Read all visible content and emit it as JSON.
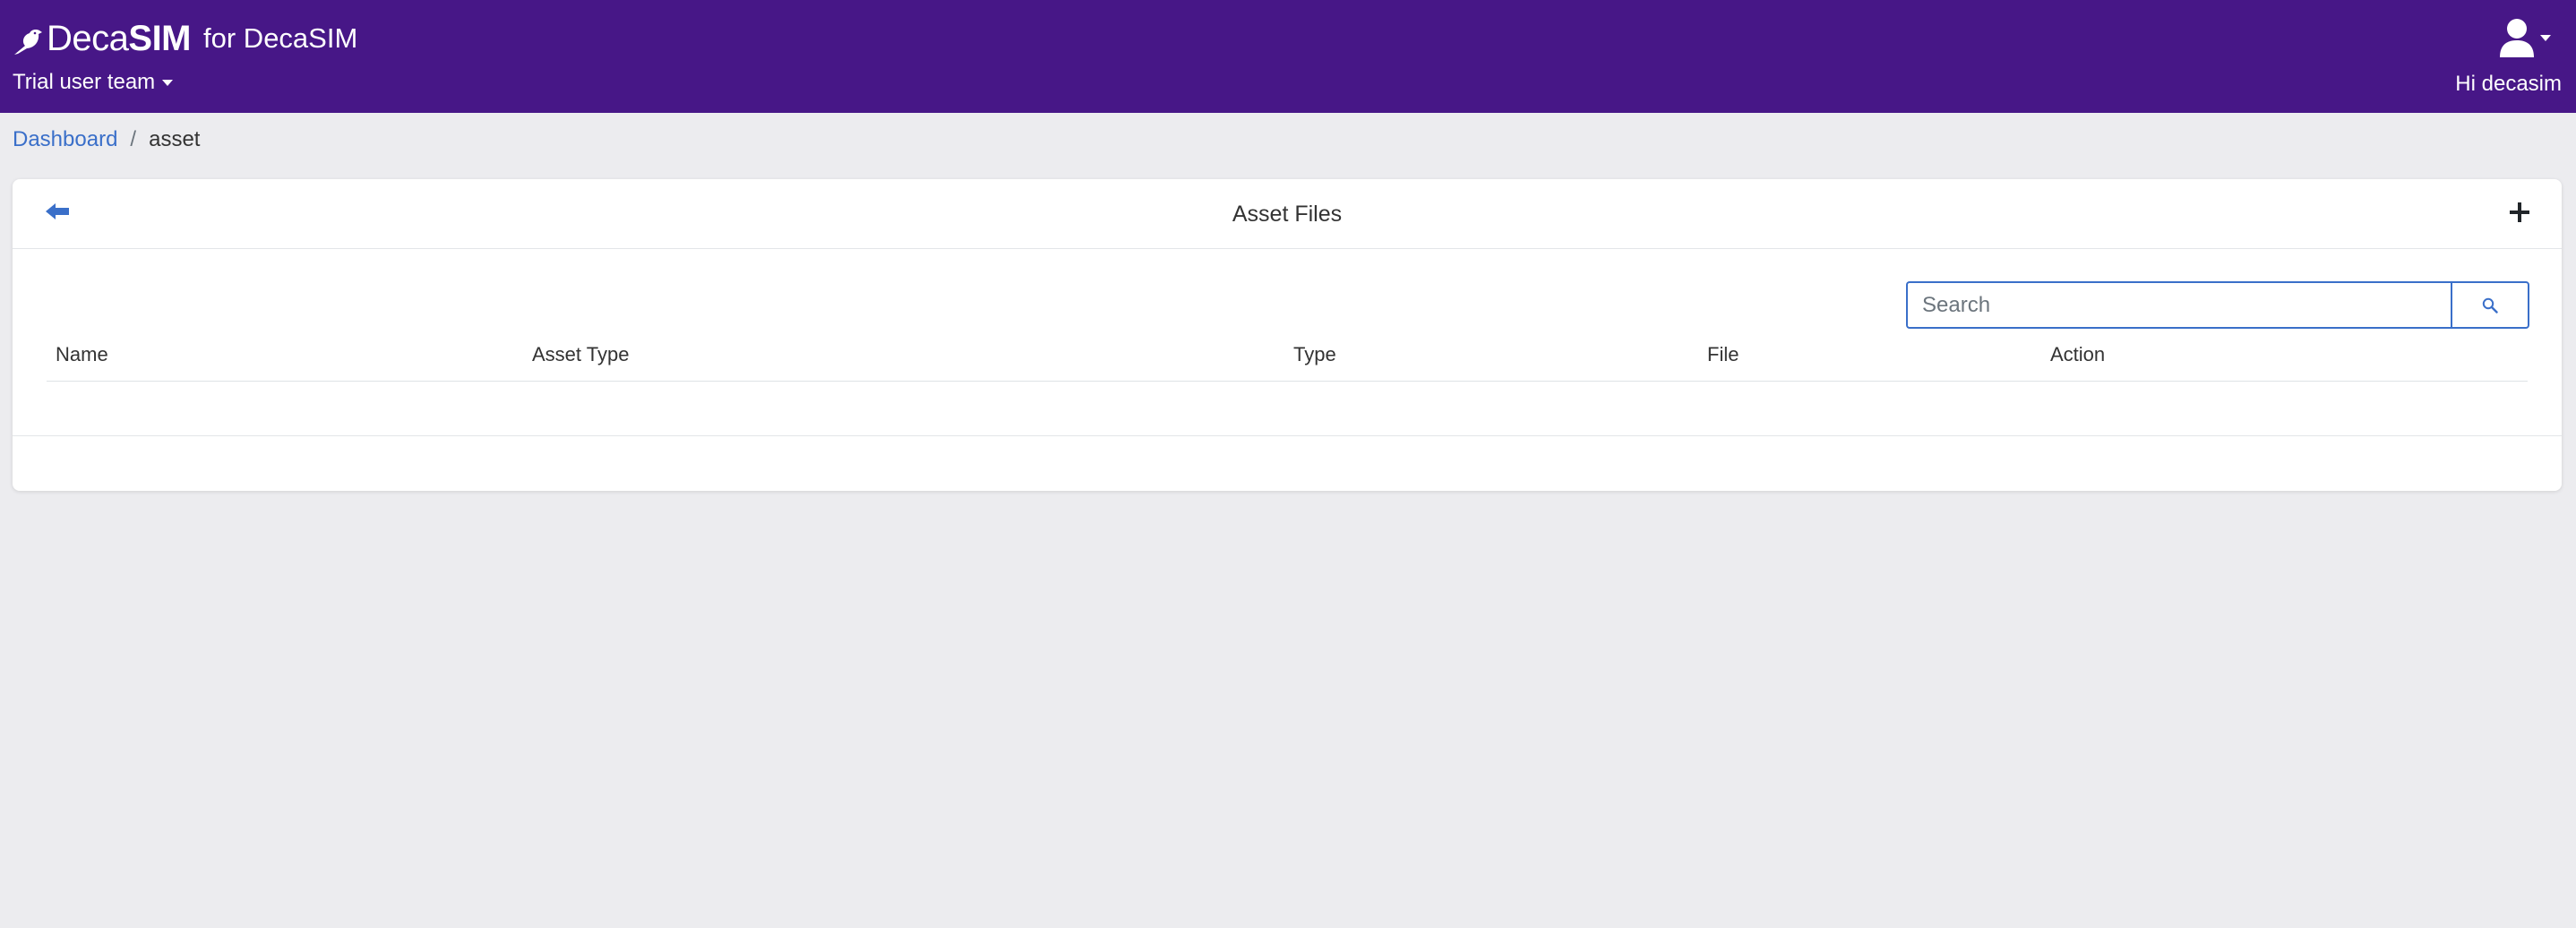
{
  "navbar": {
    "brand": {
      "logo_light": "Deca",
      "logo_bold": "SIM",
      "suffix": "for DecaSIM"
    },
    "team_selector": "Trial user team",
    "greeting": "Hi decasim",
    "icons": {
      "logo": "bird-icon",
      "user": "user-icon",
      "dropdown": "caret-down-icon"
    }
  },
  "breadcrumb": {
    "items": [
      "Dashboard",
      "asset"
    ],
    "separator": "/"
  },
  "card": {
    "title": "Asset Files",
    "icons": {
      "back": "arrow-left-icon",
      "add": "plus-icon",
      "search": "search-icon"
    },
    "search": {
      "placeholder": "Search",
      "value": ""
    },
    "table": {
      "columns": [
        "Name",
        "Asset Type",
        "Type",
        "File",
        "Action"
      ],
      "rows": []
    }
  },
  "colors": {
    "navbar_bg": "#471787",
    "page_bg": "#ececef",
    "accent": "#3a6fc9"
  }
}
